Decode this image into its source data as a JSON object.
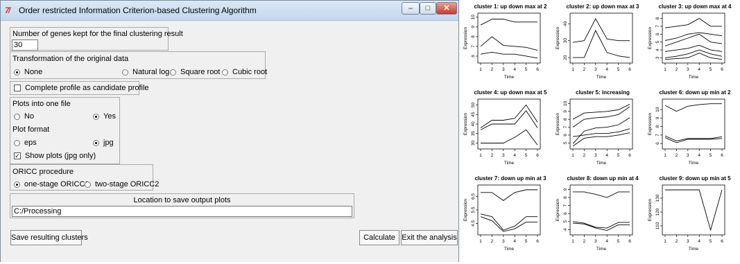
{
  "window": {
    "icon_glyph": "7̸",
    "title": "Order restricted Information Criterion-based Clustering Algorithm",
    "minimize": "–",
    "maximize": "□",
    "close": "✕"
  },
  "genes": {
    "label": "Number of genes kept for the final clustering result",
    "value": "30"
  },
  "transformation": {
    "label": "Transformation of the original data",
    "options": [
      "None",
      "Natural log",
      "Square root",
      "Cubic root"
    ],
    "selected": "None"
  },
  "complete_profile": {
    "label": "Complete profile as candidate profile",
    "checked": false
  },
  "plots": {
    "label": "Plots into one file",
    "no": "No",
    "yes": "Yes",
    "selected": "Yes",
    "format_label": "Plot format",
    "eps": "eps",
    "jpg": "jpg",
    "format_selected": "jpg",
    "show_label": "Show plots (jpg only)",
    "show_checked": true
  },
  "procedure": {
    "label": "ORICC procedure",
    "one": "one-stage ORICC1",
    "two": "two-stage ORICC2",
    "selected": "one"
  },
  "location": {
    "label": "Location to save output plots",
    "value": "C:/Processing"
  },
  "buttons": {
    "save": "Save resulting clusters",
    "calculate": "Calculate",
    "exit": "Exit the analysis"
  },
  "chart_data": [
    {
      "type": "line",
      "title": "cluster 1: up down max at 2",
      "xlabel": "Time",
      "ylabel": "Expression",
      "x": [
        1,
        2,
        3,
        4,
        5,
        6
      ],
      "ylim": [
        5.5,
        10.2
      ],
      "yticks": [
        6,
        7,
        8,
        9,
        10
      ],
      "series": [
        {
          "values": [
            9.2,
            9.8,
            9.8,
            9.5,
            9.5,
            9.5
          ]
        },
        {
          "values": [
            7.0,
            8.0,
            7.1,
            7.0,
            6.9,
            6.6
          ]
        },
        {
          "values": [
            6.2,
            6.4,
            6.2,
            6.2,
            6.0,
            5.8
          ]
        }
      ]
    },
    {
      "type": "line",
      "title": "cluster 2: up down max at 3",
      "xlabel": "Time",
      "ylabel": "Expression",
      "x": [
        1,
        2,
        3,
        4,
        5,
        6
      ],
      "ylim": [
        18,
        45
      ],
      "yticks": [
        20,
        30,
        40
      ],
      "series": [
        {
          "values": [
            29,
            30,
            43,
            31,
            30,
            30
          ]
        },
        {
          "values": [
            20,
            20,
            36,
            23,
            21,
            20
          ]
        }
      ]
    },
    {
      "type": "line",
      "title": "cluster 3: up down max at 4",
      "xlabel": "Time",
      "ylabel": "Expression",
      "x": [
        1,
        2,
        3,
        4,
        5,
        6
      ],
      "ylim": [
        2.6,
        8.4
      ],
      "yticks": [
        3,
        4,
        5,
        6,
        7,
        8
      ],
      "series": [
        {
          "values": [
            6.8,
            7.0,
            7.2,
            8.0,
            7.0,
            7.0
          ]
        },
        {
          "values": [
            5.2,
            5.5,
            6.0,
            6.2,
            6.0,
            5.8
          ]
        },
        {
          "values": [
            4.5,
            5.0,
            5.5,
            6.0,
            5.0,
            4.8
          ]
        },
        {
          "values": [
            3.8,
            4.0,
            4.2,
            4.6,
            4.0,
            3.8
          ]
        },
        {
          "values": [
            3.0,
            3.2,
            3.5,
            4.0,
            3.5,
            3.2
          ]
        },
        {
          "values": [
            2.8,
            2.9,
            3.0,
            3.6,
            3.0,
            2.8
          ]
        }
      ]
    },
    {
      "type": "line",
      "title": "cluster 4: up down max at 5",
      "xlabel": "Time",
      "ylabel": "Expression",
      "x": [
        1,
        2,
        3,
        4,
        5,
        6
      ],
      "ylim": [
        28,
        52
      ],
      "yticks": [
        30,
        35,
        40,
        45,
        50
      ],
      "series": [
        {
          "values": [
            38,
            42,
            42,
            43,
            50,
            41
          ]
        },
        {
          "values": [
            37,
            40,
            40,
            40,
            47,
            38
          ]
        },
        {
          "values": [
            30,
            30,
            30,
            33,
            37,
            29
          ]
        }
      ]
    },
    {
      "type": "line",
      "title": "cluster 5: increasing",
      "xlabel": "Time",
      "ylabel": "Expression",
      "x": [
        1,
        2,
        3,
        4,
        5,
        6
      ],
      "ylim": [
        4.5,
        10.3
      ],
      "yticks": [
        5,
        6,
        7,
        8,
        9,
        10
      ],
      "series": [
        {
          "values": [
            8.0,
            8.8,
            8.9,
            9.0,
            9.2,
            9.9
          ]
        },
        {
          "values": [
            7.0,
            8.0,
            8.2,
            8.3,
            8.6,
            9.6
          ]
        },
        {
          "values": [
            5.8,
            6.0,
            6.2,
            6.2,
            6.4,
            6.8
          ]
        },
        {
          "values": [
            4.9,
            6.5,
            6.9,
            7.0,
            7.3,
            8.2
          ]
        },
        {
          "values": [
            4.6,
            5.6,
            5.8,
            5.8,
            6.0,
            6.3
          ]
        }
      ]
    },
    {
      "type": "line",
      "title": "cluster 6: down up min at 2",
      "xlabel": "Time",
      "ylabel": "Expression",
      "x": [
        1,
        2,
        3,
        4,
        5,
        6
      ],
      "ylim": [
        5.6,
        11
      ],
      "yticks": [
        6,
        7,
        8,
        9,
        10
      ],
      "series": [
        {
          "values": [
            10.5,
            9.8,
            10.4,
            10.6,
            10.7,
            10.7
          ]
        },
        {
          "values": [
            6.9,
            6.3,
            6.6,
            6.6,
            6.6,
            6.8
          ]
        },
        {
          "values": [
            6.7,
            6.1,
            6.5,
            6.5,
            6.5,
            6.6
          ]
        }
      ]
    },
    {
      "type": "line",
      "title": "cluster 7: down up min at 3",
      "xlabel": "Time",
      "ylabel": "Expression",
      "x": [
        1,
        2,
        3,
        4,
        5,
        6
      ],
      "ylim": [
        3.8,
        7.2
      ],
      "yticks": [
        4.5,
        5.5,
        6.5
      ],
      "series": [
        {
          "values": [
            6.8,
            6.8,
            6.2,
            6.8,
            7.0,
            7.0
          ]
        },
        {
          "values": [
            5.2,
            5.0,
            4.0,
            4.3,
            5.0,
            5.0
          ]
        },
        {
          "values": [
            5.0,
            4.7,
            3.9,
            4.1,
            4.6,
            4.6
          ]
        }
      ]
    },
    {
      "type": "line",
      "title": "cluster 8: down up min at 4",
      "xlabel": "Time",
      "ylabel": "Expression",
      "x": [
        1,
        2,
        3,
        4,
        5,
        6
      ],
      "ylim": [
        3.6,
        9.3
      ],
      "yticks": [
        4,
        5,
        6,
        7,
        8,
        9
      ],
      "series": [
        {
          "values": [
            8.7,
            8.7,
            8.4,
            8.0,
            8.7,
            8.7
          ]
        },
        {
          "values": [
            5.0,
            4.8,
            4.3,
            4.2,
            4.9,
            4.9
          ]
        },
        {
          "values": [
            4.8,
            4.7,
            4.2,
            3.9,
            4.6,
            4.6
          ]
        }
      ]
    },
    {
      "type": "line",
      "title": "cluster 9: down up min at 5",
      "xlabel": "Time",
      "ylabel": "Expression",
      "x": [
        1,
        2,
        3,
        4,
        5,
        6
      ],
      "ylim": [
        105,
        138
      ],
      "yticks": [
        110,
        120,
        130
      ],
      "series": [
        {
          "values": [
            136,
            136,
            136,
            136,
            107,
            136
          ]
        }
      ]
    }
  ]
}
